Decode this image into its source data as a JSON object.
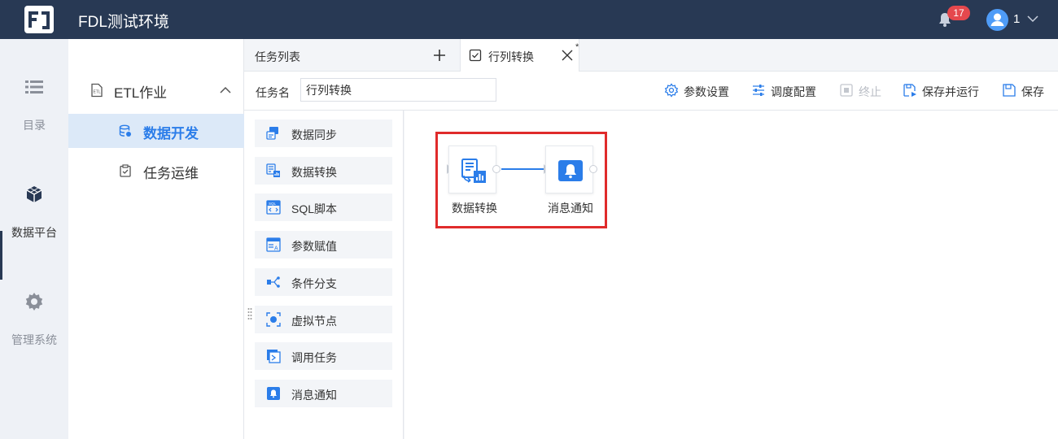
{
  "header": {
    "app_title": "FDL测试环境",
    "notification_count": "17",
    "user_name": "1"
  },
  "rail": {
    "items": [
      {
        "label": "目录",
        "icon": "list-icon"
      },
      {
        "label": "数据平台",
        "icon": "cube-icon"
      },
      {
        "label": "管理系统",
        "icon": "gear-icon"
      }
    ],
    "active_index": 1
  },
  "subnav": {
    "group_label": "ETL作业",
    "items": [
      {
        "label": "数据开发",
        "active": true
      },
      {
        "label": "任务运维",
        "active": false
      }
    ]
  },
  "tabs": {
    "list_label": "任务列表",
    "active_tab_label": "行列转换",
    "modified_marker": "*"
  },
  "toolbar": {
    "task_name_label": "任务名",
    "task_name_value": "行列转换",
    "buttons": {
      "params": "参数设置",
      "schedule": "调度配置",
      "stop": "终止",
      "save_run": "保存并运行",
      "save": "保存"
    }
  },
  "palette": {
    "items": [
      {
        "label": "数据同步",
        "icon": "data-sync-icon"
      },
      {
        "label": "数据转换",
        "icon": "data-transform-icon"
      },
      {
        "label": "SQL脚本",
        "icon": "sql-script-icon"
      },
      {
        "label": "参数赋值",
        "icon": "param-assign-icon"
      },
      {
        "label": "条件分支",
        "icon": "condition-branch-icon"
      },
      {
        "label": "虚拟节点",
        "icon": "virtual-node-icon"
      },
      {
        "label": "调用任务",
        "icon": "call-task-icon"
      },
      {
        "label": "消息通知",
        "icon": "message-notify-icon"
      }
    ]
  },
  "canvas": {
    "nodes": [
      {
        "label": "数据转换",
        "icon": "data-transform-icon"
      },
      {
        "label": "消息通知",
        "icon": "bell-icon"
      }
    ],
    "highlight_color": "#e02b2b"
  },
  "colors": {
    "header_bg": "#283954",
    "accent": "#2b7de9",
    "badge": "#e5484d"
  }
}
